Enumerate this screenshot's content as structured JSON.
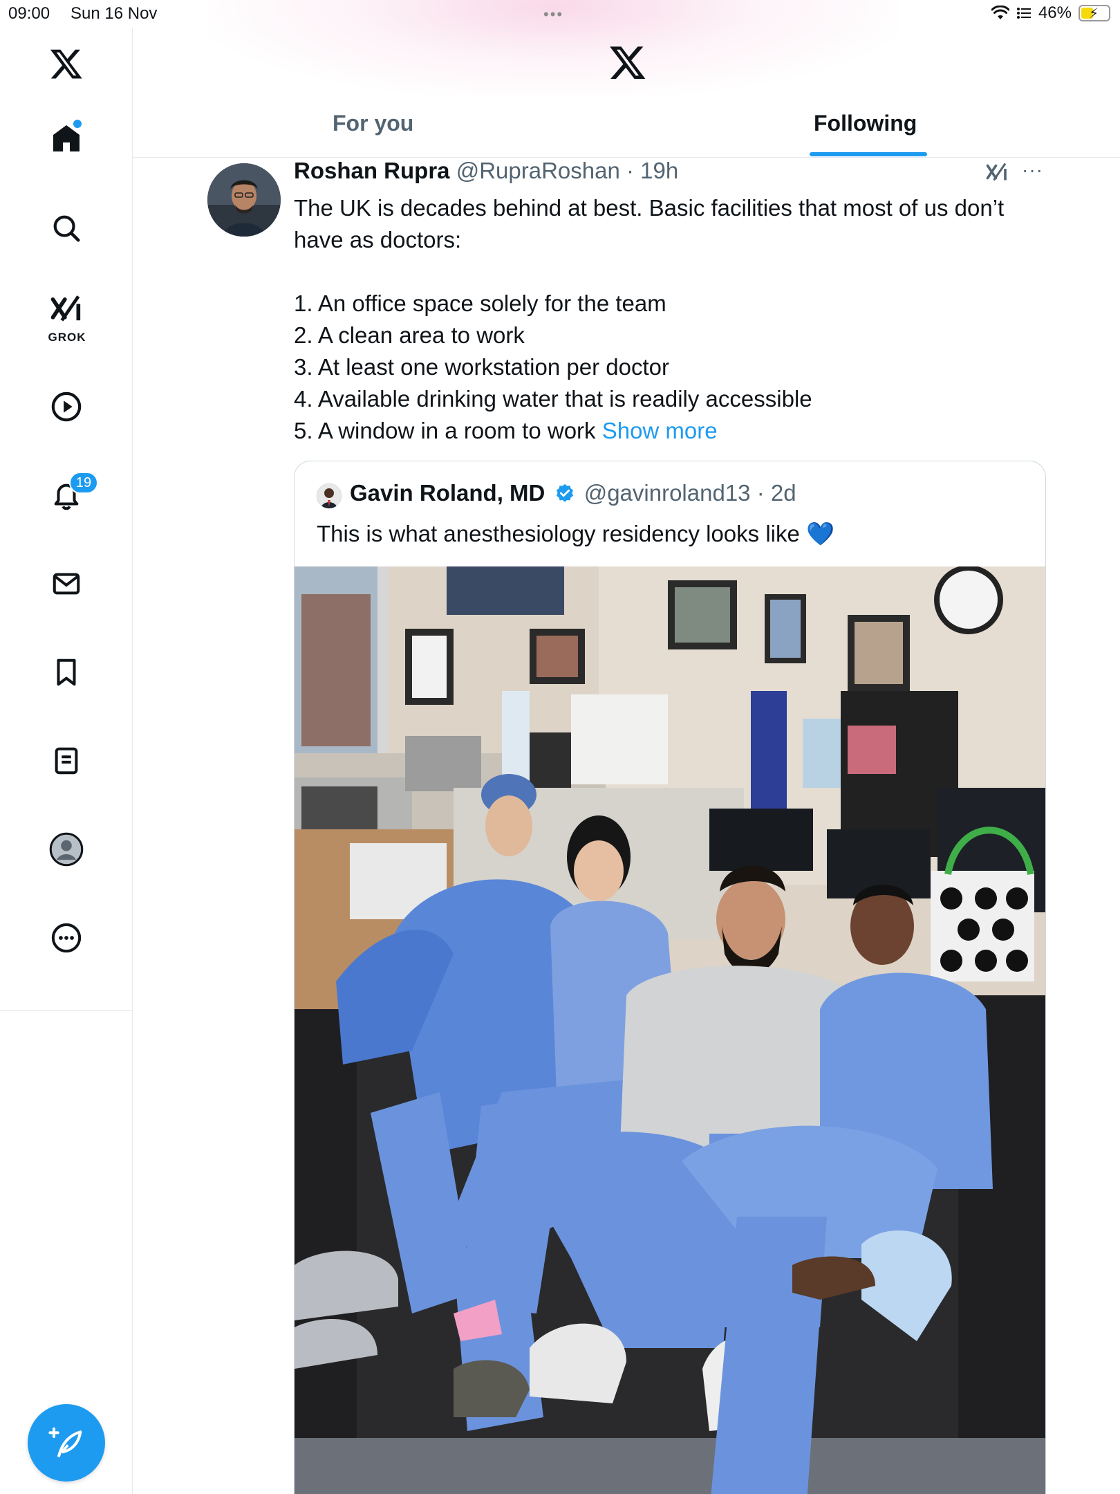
{
  "status_bar": {
    "time": "09:00",
    "date": "Sun 16 Nov",
    "battery": "46%",
    "battery_level": 0.46
  },
  "sidebar": {
    "notifications_badge": "19",
    "grok_label": "GROK",
    "items": [
      {
        "icon": "x-logo-icon"
      },
      {
        "icon": "home-icon"
      },
      {
        "icon": "search-icon"
      },
      {
        "icon": "grok-icon"
      },
      {
        "icon": "video-icon"
      },
      {
        "icon": "notifications-bell-icon"
      },
      {
        "icon": "messages-envelope-icon"
      },
      {
        "icon": "bookmark-icon"
      },
      {
        "icon": "lists-icon"
      },
      {
        "icon": "profile-icon"
      },
      {
        "icon": "more-icon"
      }
    ],
    "compose_icon": "compose-feather-icon"
  },
  "tabs": {
    "for_you": "For you",
    "following": "Following",
    "active": "Following"
  },
  "post": {
    "author_name": "Roshan Rupra",
    "author_handle": "@RupraRoshan",
    "time": "19h",
    "text_intro": "The UK is decades behind at best. Basic facilities that most of us don’t have as doctors:",
    "list": [
      "1. An office space solely for the team",
      "2. A clean area to work",
      "3. At least one workstation per doctor",
      "4. Available drinking water that is readily accessible",
      "5. A window in a room to work"
    ],
    "show_more": "Show more"
  },
  "quote": {
    "author_name": "Gavin Roland, MD",
    "author_handle": "@gavinroland13",
    "time": "2d",
    "text": "This is what anesthesiology residency looks like",
    "emoji": "💙"
  },
  "colors": {
    "accent": "#1d9bf0",
    "text_primary": "#0f1419",
    "text_secondary": "#536471",
    "border": "#cfd9de"
  }
}
